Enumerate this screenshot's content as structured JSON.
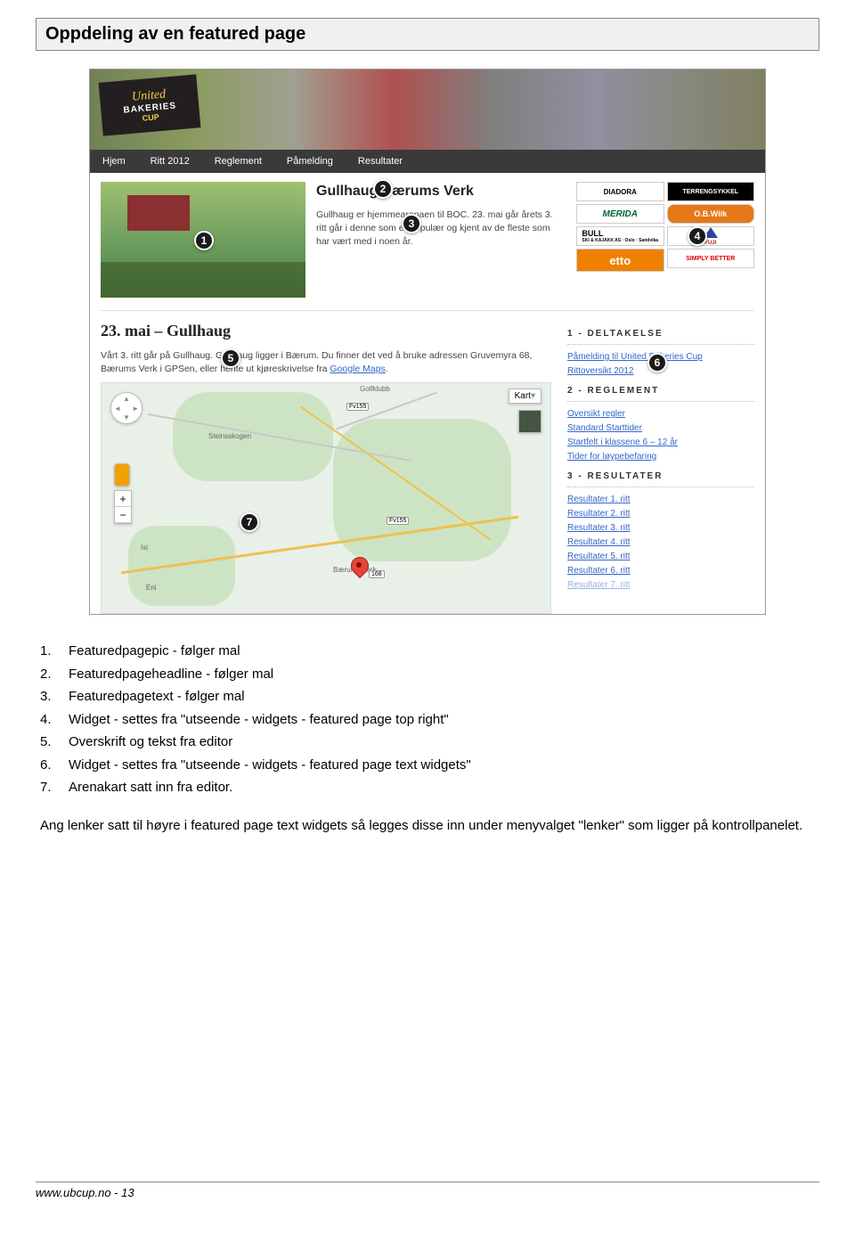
{
  "title": "Oppdeling av en featured page",
  "banner": {
    "logo_script": "United",
    "logo_bak": "BAKERIES",
    "logo_cup": "CUP"
  },
  "nav": [
    "Hjem",
    "Ritt 2012",
    "Reglement",
    "Påmelding",
    "Resultater"
  ],
  "feature": {
    "headline": "Gullhaug Bærums Verk",
    "text": "Gullhaug er hjemmearenaen til BOC. 23. mai går årets 3. ritt går i denne som er populær og kjent av de fleste som har vært med i noen år."
  },
  "sponsors": {
    "diadora": "DIADORA",
    "terreng": "TERRENGSYKKEL",
    "merida": "MERIDA",
    "obwiik": "O.B.Wiik",
    "bull": "BULL",
    "bull_sub": "SKI & KAJAKK AS · Oslo · Sandvika",
    "fuji": "FUJI",
    "etto": "etto",
    "simply": "SIMPLY BETTER"
  },
  "main": {
    "heading": "23. mai – Gullhaug",
    "para_a": "Vårt 3. ritt går på Gullhaug. Gullhaug ligger i Bærum. Du finner det ved å bruke adressen Gruvemyra 68, Bærums Verk i GPSen, eller hente ut kjøreskrivelse fra ",
    "para_link": "Google Maps",
    "para_b": "."
  },
  "sidebar": {
    "sec1_title": "1 - DELTAKELSE",
    "sec1_links": [
      "Påmelding til United Bakeries Cup",
      "Rittoversikt 2012"
    ],
    "sec2_title": "2 - REGLEMENT",
    "sec2_links": [
      "Oversikt regler",
      "Standard Starttider",
      "Startfelt i klassene 6 – 12 år",
      "Tider for løypebefaring"
    ],
    "sec3_title": "3 - RESULTATER",
    "sec3_links": [
      "Resultater 1. ritt",
      "Resultater 2. ritt",
      "Resultater 3. ritt",
      "Resultater 4. ritt",
      "Resultater 5. ritt",
      "Resultater 6. ritt",
      "Resultater 7. ritt"
    ]
  },
  "map": {
    "places": [
      "Steinsskogen",
      "Bærums Verk",
      "Isi",
      "Eni",
      "Golfklubb"
    ],
    "roads": [
      "Fv155",
      "Fv168",
      "168"
    ],
    "type_label": "Kart"
  },
  "badges": {
    "b1": "1",
    "b2": "2",
    "b3": "3",
    "b4": "4",
    "b5": "5",
    "b6": "6",
    "b7": "7"
  },
  "list": [
    {
      "n": "1.",
      "t": "Featuredpagepic - følger mal"
    },
    {
      "n": "2.",
      "t": "Featuredpageheadline - følger mal"
    },
    {
      "n": "3.",
      "t": "Featuredpagetext - følger mal"
    },
    {
      "n": "4.",
      "t": "Widget - settes fra \"utseende - widgets - featured page top right\""
    },
    {
      "n": "5.",
      "t": "Overskrift og tekst fra editor"
    },
    {
      "n": "6.",
      "t": "Widget  - settes fra  \"utseende - widgets - featured page text widgets\""
    },
    {
      "n": "7.",
      "t": "Arenakart satt inn fra editor."
    }
  ],
  "para": "Ang lenker satt til høyre i featured page text widgets så legges disse inn under menyvalget \"lenker\" som ligger på kontrollpanelet.",
  "footer": "www.ubcup.no - 13"
}
